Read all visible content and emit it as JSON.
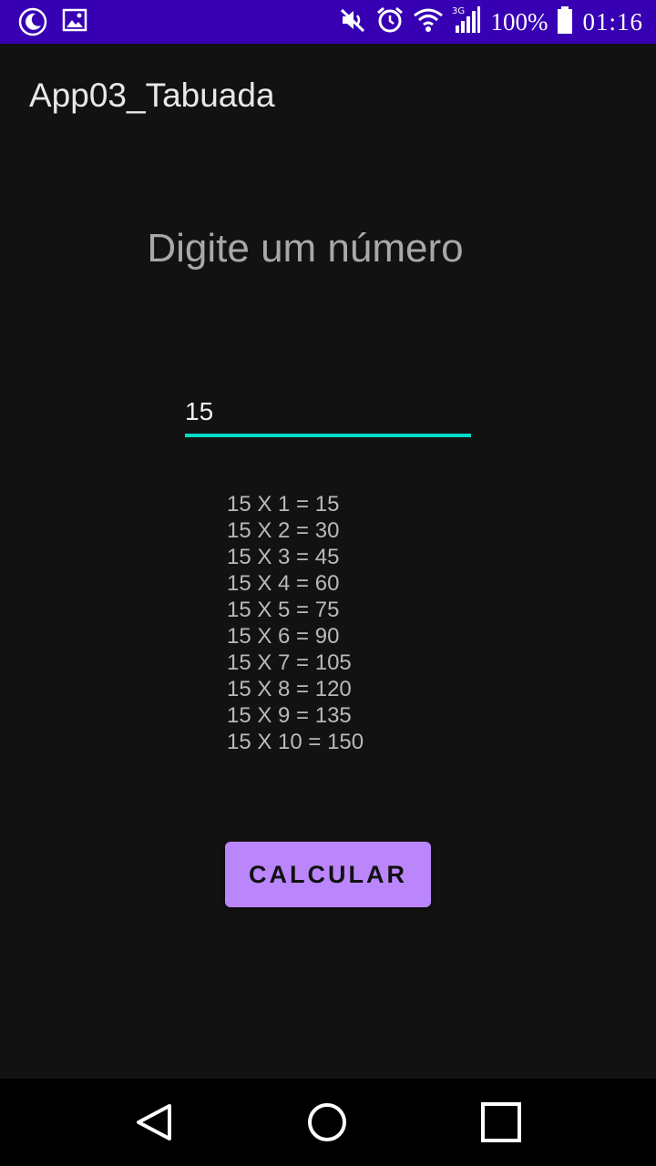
{
  "status_bar": {
    "battery_percent": "100%",
    "time": "01:16",
    "network": "3G",
    "icons": [
      "moon-icon",
      "image-icon",
      "mute-icon",
      "alarm-icon",
      "wifi-icon",
      "signal-icon",
      "battery-icon"
    ]
  },
  "app_bar": {
    "title": "App03_Tabuada"
  },
  "main": {
    "prompt": "Digite um número",
    "number_input": {
      "value": "15"
    },
    "results": [
      "15 X 1 = 15",
      "15 X 2 = 30",
      "15 X 3 = 45",
      "15 X 4 = 60",
      "15 X 5 = 75",
      "15 X 6 = 90",
      "15 X 7 = 105",
      "15 X 8 = 120",
      "15 X 9 = 135",
      "15 X 10 = 150"
    ],
    "calculate_label": "Calcular"
  },
  "colors": {
    "status_bar": "#3700b3",
    "background": "#121212",
    "accent": "#03dac5",
    "button": "#bb86fc"
  },
  "nav_bar": {
    "icons": [
      "back-icon",
      "home-icon",
      "recents-icon"
    ]
  }
}
